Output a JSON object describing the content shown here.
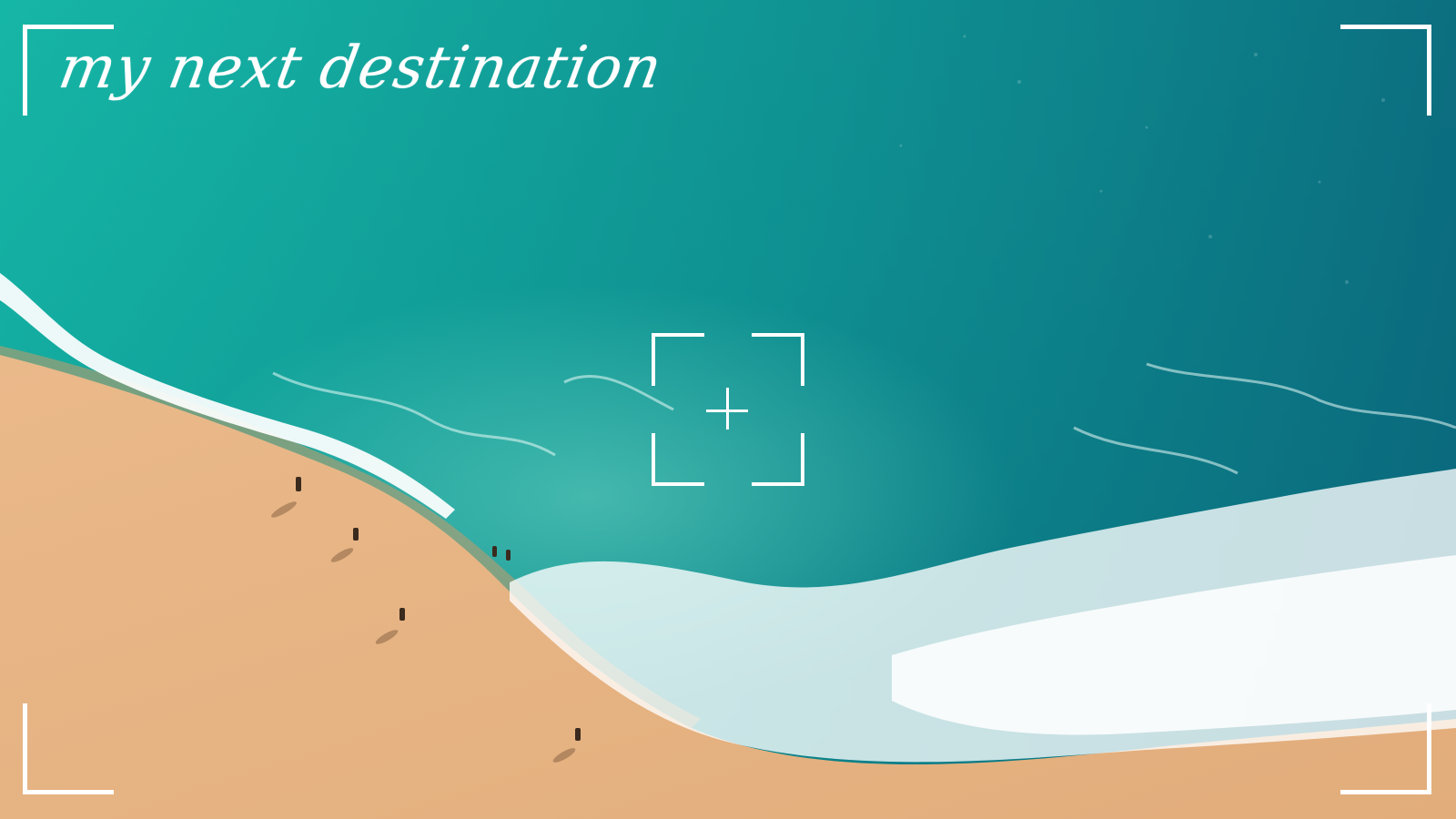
{
  "title_text": "my next destination",
  "colors": {
    "deep_sea": "#0b7f88",
    "shallow_sea": "#14b7a4",
    "foam": "#ffffff",
    "sand": "#e7b987",
    "frame": "#ffffff"
  },
  "icons": [
    "viewfinder-frame-icon",
    "focus-reticle-icon",
    "crosshair-icon"
  ]
}
